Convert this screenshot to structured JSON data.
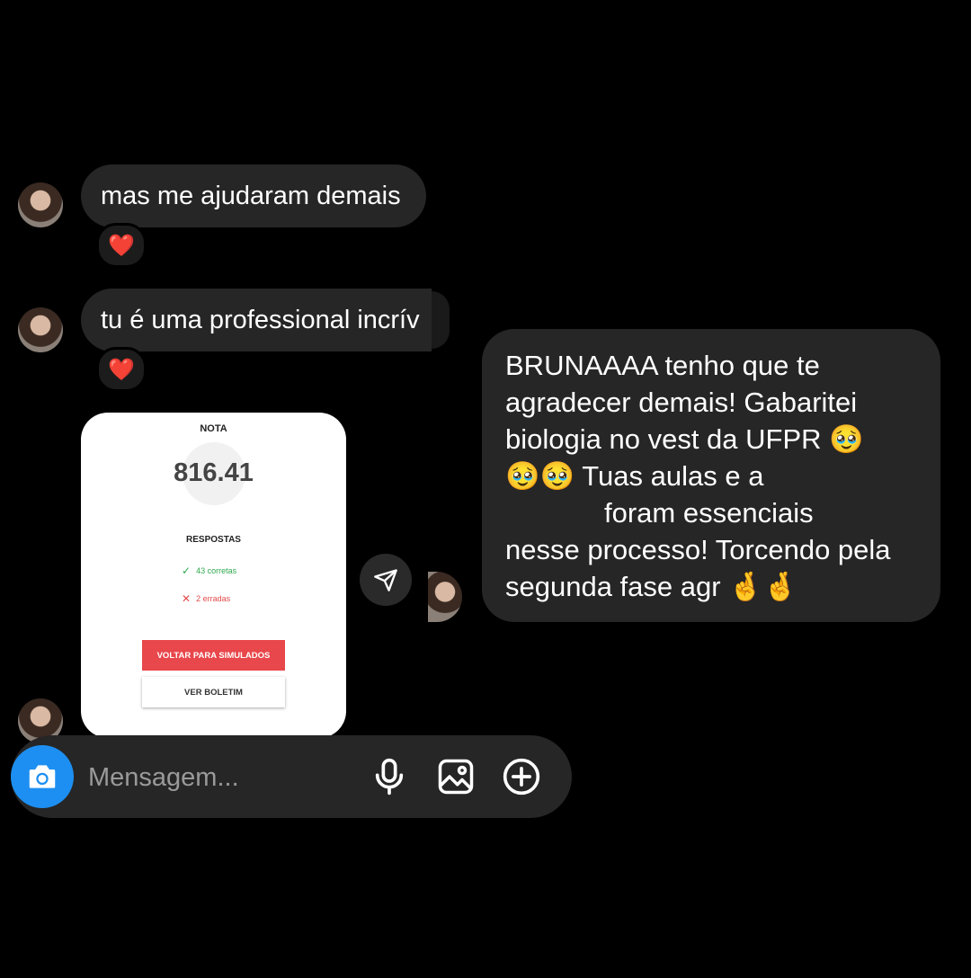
{
  "messages": {
    "m1": {
      "text": "mas me ajudaram demais",
      "reaction": "❤️"
    },
    "m2": {
      "text": "tu é uma professional incrív",
      "reaction": "❤️"
    },
    "card": {
      "nota_label": "NOTA",
      "nota_value": "816.41",
      "respostas_label": "RESPOSTAS",
      "correct_text": "43 corretas",
      "wrong_text": "2 erradas",
      "primary_button": "VOLTAR PARA SIMULADOS",
      "secondary_button": "VER BOLETIM"
    },
    "outgoing": {
      "lines": [
        "BRUNAAAA tenho que te",
        "agradecer demais! Gabaritei",
        "biologia no vest da UFPR 🥹",
        "🥹🥹 Tuas aulas e a",
        "foram essenciais",
        "nesse processo! Torcendo pela",
        "segunda fase agr 🤞🤞"
      ]
    }
  },
  "composer": {
    "placeholder": "Mensagem...",
    "icons": [
      "camera-icon",
      "microphone-icon",
      "gallery-icon",
      "add-circle-icon"
    ]
  },
  "colors": {
    "background": "#000000",
    "bubble": "#262626",
    "accent_blue": "#1d8ff2",
    "card_button_red": "#e8474b",
    "correct_green": "#2fa94f",
    "wrong_red": "#e24a4a"
  }
}
